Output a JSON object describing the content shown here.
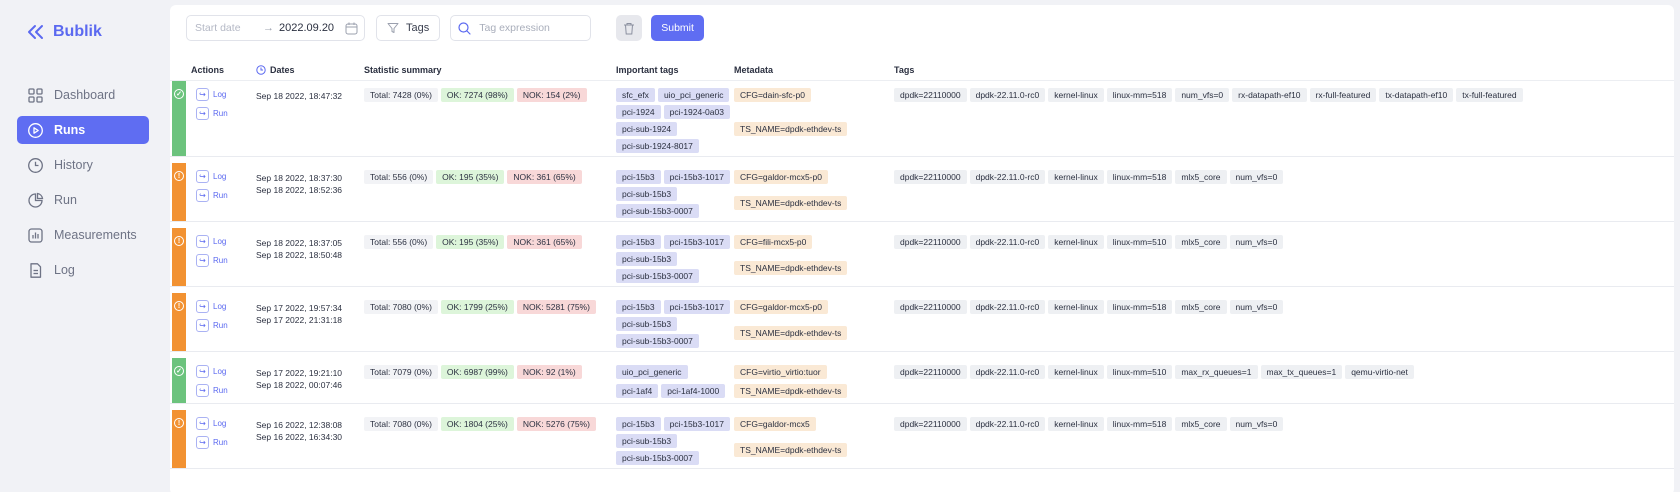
{
  "brand": {
    "name": "Bublik"
  },
  "nav": [
    {
      "label": "Dashboard",
      "icon": "grid-icon",
      "active": false
    },
    {
      "label": "Runs",
      "icon": "play-circle-icon",
      "active": true
    },
    {
      "label": "History",
      "icon": "clock-icon",
      "active": false
    },
    {
      "label": "Run",
      "icon": "pie-chart-icon",
      "active": false
    },
    {
      "label": "Measurements",
      "icon": "bar-chart-icon",
      "active": false
    },
    {
      "label": "Log",
      "icon": "document-icon",
      "active": false
    }
  ],
  "toolbar": {
    "start_placeholder": "Start date",
    "arrow": "→",
    "end_date": "2022.09.20",
    "tags_label": "Tags",
    "search_placeholder": "Tag expression",
    "submit_label": "Submit"
  },
  "table": {
    "headers": {
      "actions": "Actions",
      "dates": "Dates",
      "summary": "Statistic summary",
      "important": "Important tags",
      "metadata": "Metadata",
      "tags": "Tags"
    },
    "log_label": "Log",
    "run_label": "Run",
    "rows": [
      {
        "status": "ok",
        "start": "Sep 18 2022, 18:47:32",
        "end": "",
        "total": "Total: 7428 (0%)",
        "ok": "OK: 7274 (98%)",
        "nok": "NOK: 154 (2%)",
        "important": [
          "sfc_efx",
          "uio_pci_generic",
          "pci-1924",
          "pci-1924-0a03",
          "pci-sub-1924",
          "pci-sub-1924-8017"
        ],
        "meta": [
          "CFG=dain-sfc-p0",
          "TS_NAME=dpdk-ethdev-ts"
        ],
        "tags": [
          "dpdk=22110000",
          "dpdk-22.11.0-rc0",
          "kernel-linux",
          "linux-mm=518",
          "num_vfs=0",
          "rx-datapath-ef10",
          "rx-full-featured",
          "tx-datapath-ef10",
          "tx-full-featured"
        ]
      },
      {
        "status": "warn",
        "start": "Sep 18 2022, 18:37:30",
        "end": "Sep 18 2022, 18:52:36",
        "total": "Total: 556 (0%)",
        "ok": "OK: 195 (35%)",
        "nok": "NOK: 361 (65%)",
        "important": [
          "pci-15b3",
          "pci-15b3-1017",
          "pci-sub-15b3",
          "pci-sub-15b3-0007"
        ],
        "meta": [
          "CFG=galdor-mcx5-p0",
          "TS_NAME=dpdk-ethdev-ts"
        ],
        "tags": [
          "dpdk=22110000",
          "dpdk-22.11.0-rc0",
          "kernel-linux",
          "linux-mm=518",
          "mlx5_core",
          "num_vfs=0"
        ]
      },
      {
        "status": "warn",
        "start": "Sep 18 2022, 18:37:05",
        "end": "Sep 18 2022, 18:50:48",
        "total": "Total: 556 (0%)",
        "ok": "OK: 195 (35%)",
        "nok": "NOK: 361 (65%)",
        "important": [
          "pci-15b3",
          "pci-15b3-1017",
          "pci-sub-15b3",
          "pci-sub-15b3-0007"
        ],
        "meta": [
          "CFG=fili-mcx5-p0",
          "TS_NAME=dpdk-ethdev-ts"
        ],
        "tags": [
          "dpdk=22110000",
          "dpdk-22.11.0-rc0",
          "kernel-linux",
          "linux-mm=510",
          "mlx5_core",
          "num_vfs=0"
        ]
      },
      {
        "status": "warn",
        "start": "Sep 17 2022, 19:57:34",
        "end": "Sep 17 2022, 21:31:18",
        "total": "Total: 7080 (0%)",
        "ok": "OK: 1799 (25%)",
        "nok": "NOK: 5281 (75%)",
        "important": [
          "pci-15b3",
          "pci-15b3-1017",
          "pci-sub-15b3",
          "pci-sub-15b3-0007"
        ],
        "meta": [
          "CFG=galdor-mcx5-p0",
          "TS_NAME=dpdk-ethdev-ts"
        ],
        "tags": [
          "dpdk=22110000",
          "dpdk-22.11.0-rc0",
          "kernel-linux",
          "linux-mm=518",
          "mlx5_core",
          "num_vfs=0"
        ]
      },
      {
        "status": "ok",
        "start": "Sep 17 2022, 19:21:10",
        "end": "Sep 18 2022, 00:07:46",
        "total": "Total: 7079 (0%)",
        "ok": "OK: 6987 (99%)",
        "nok": "NOK: 92 (1%)",
        "important": [
          "uio_pci_generic",
          "pci-1af4",
          "pci-1af4-1000"
        ],
        "meta": [
          "CFG=virtio_virtio:tuor",
          "TS_NAME=dpdk-ethdev-ts"
        ],
        "tags": [
          "dpdk=22110000",
          "dpdk-22.11.0-rc0",
          "kernel-linux",
          "linux-mm=510",
          "max_rx_queues=1",
          "max_tx_queues=1",
          "qemu-virtio-net"
        ]
      },
      {
        "status": "warn",
        "start": "Sep 16 2022, 12:38:08",
        "end": "Sep 16 2022, 16:34:30",
        "total": "Total: 7080 (0%)",
        "ok": "OK: 1804 (25%)",
        "nok": "NOK: 5276 (75%)",
        "important": [
          "pci-15b3",
          "pci-15b3-1017",
          "pci-sub-15b3",
          "pci-sub-15b3-0007"
        ],
        "meta": [
          "CFG=galdor-mcx5",
          "TS_NAME=dpdk-ethdev-ts"
        ],
        "tags": [
          "dpdk=22110000",
          "dpdk-22.11.0-rc0",
          "kernel-linux",
          "linux-mm=518",
          "mlx5_core",
          "num_vfs=0"
        ]
      }
    ]
  }
}
